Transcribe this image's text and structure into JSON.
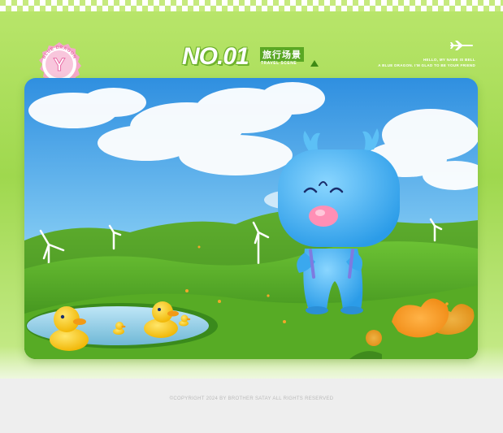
{
  "badge": {
    "text": "BLUE DRAGON",
    "colors": {
      "ring": "#f4a8c8",
      "fill": "#ffffff",
      "letter": "#e96fa7"
    }
  },
  "header": {
    "number": "NO.01",
    "subtitle_cn": "旅行场景",
    "subtitle_en": "TRAVEL SCENE",
    "hello_line1": "HELLO, MY NAME IS BELL",
    "hello_line2": "A BLUE DRAGON. I'M GLAD TO BE YOUR FRIEND",
    "plane_icon": "airplane-icon"
  },
  "footer": {
    "copyright": "©COPYRIGHT 2024 BY BROTHER SATAY ALL RIGHTS RESERVED"
  },
  "colors": {
    "band": "#a8dc5a",
    "accent_green": "#5aa824",
    "dragon_blue": "#4fb8f5",
    "duck_yellow": "#ffd23a"
  }
}
